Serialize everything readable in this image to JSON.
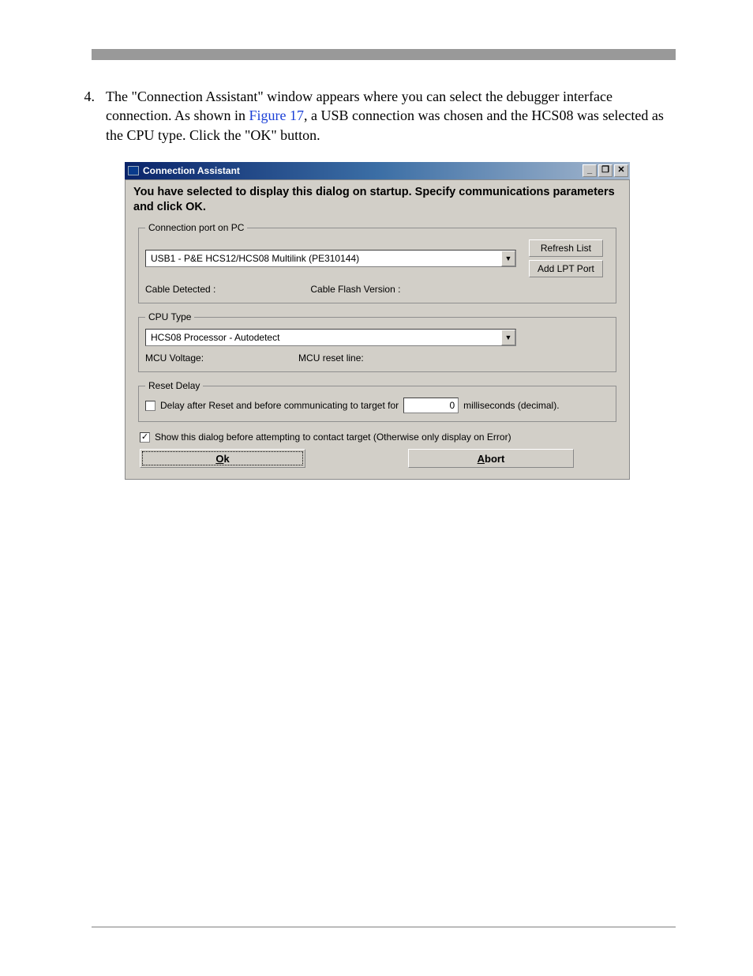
{
  "step": {
    "number": "4.",
    "line1a": "The \"Connection Assistant\" window appears where you can select the debugger interface connection. As shown in ",
    "figref": "Figure 17",
    "line1b": ", a USB connection was chosen and the HCS08 was selected as the CPU type. Click the \"OK\" button."
  },
  "dialog": {
    "title": "Connection Assistant",
    "headline": "You have selected to display this dialog on startup. Specify communications parameters and click OK.",
    "winbtns": {
      "min": "_",
      "max": "❐",
      "close": "✕"
    },
    "connGroup": {
      "legend": "Connection port on PC",
      "port": "USB1 - P&E HCS12/HCS08 Multilink (PE310144)",
      "refresh": "Refresh List",
      "addlpt": "Add LPT Port",
      "cableDetectedLabel": "Cable Detected :",
      "cableFlashLabel": "Cable Flash Version :"
    },
    "cpuGroup": {
      "legend": "CPU Type",
      "cpu": "HCS08 Processor - Autodetect",
      "mcuVoltage": "MCU Voltage:",
      "mcuReset": "MCU reset line:"
    },
    "resetGroup": {
      "legend": "Reset Delay",
      "delayLabel": "Delay after Reset and before communicating to target for",
      "delayValue": "0",
      "delayUnits": "milliseconds (decimal)."
    },
    "showDialog": {
      "checked": true,
      "label": "Show this dialog before attempting to contact target (Otherwise only display on Error)"
    },
    "ok": {
      "u": "O",
      "rest": "k"
    },
    "abort": {
      "u": "A",
      "rest": "bort"
    }
  }
}
